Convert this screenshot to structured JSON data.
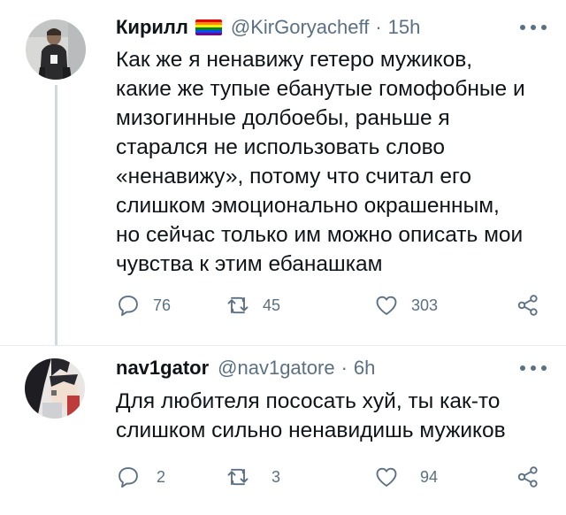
{
  "tweets": [
    {
      "display_name": "Кирилл",
      "handle": "@KirGoryacheff",
      "separator": "·",
      "time": "15h",
      "badge_colors": [
        "#e40303",
        "#ff8c00",
        "#ffed00",
        "#008026",
        "#004dff",
        "#750787"
      ],
      "text_lines": [
        "Как же я ненавижу гетеро мужиков,",
        "какие же тупые ебанутые гомофобные и",
        "мизогинные долбоебы, раньше я",
        "старался не использовать слово",
        "«ненавижу», потому что считал его",
        "слишком эмоционально окрашенным,",
        "но сейчас только им можно описать мои",
        "чувства к этим ебанашкам"
      ],
      "replies": "76",
      "retweets": "45",
      "likes": "303",
      "icons": [
        "avatar",
        "more-icon",
        "reply-icon",
        "retweet-icon",
        "like-icon",
        "share-icon"
      ]
    },
    {
      "display_name": "nav1gator",
      "handle": "@nav1gatore",
      "separator": "·",
      "time": "6h",
      "text_lines": [
        "Для любителя пососать хуй, ты как-то",
        "слишком сильно ненавидишь мужиков"
      ],
      "replies": "2",
      "retweets": "3",
      "likes": "94",
      "icons": [
        "avatar",
        "more-icon",
        "reply-icon",
        "retweet-icon",
        "like-icon",
        "share-icon"
      ]
    }
  ],
  "colors": {
    "text": "#0f1419",
    "secondary": "#5b7083",
    "thread_line": "#cfd9de"
  }
}
